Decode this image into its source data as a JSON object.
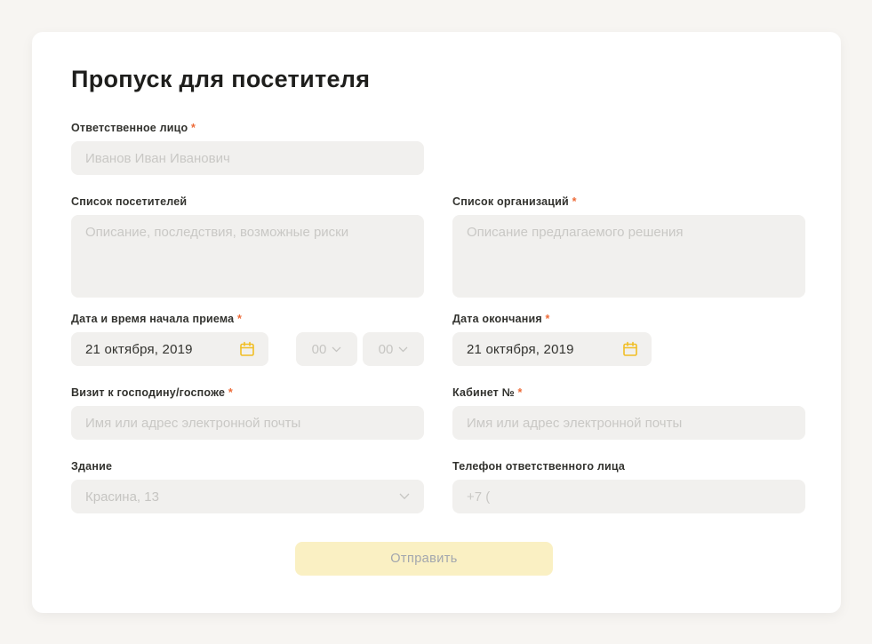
{
  "page": {
    "title": "Пропуск для посетителя"
  },
  "required_marker": "*",
  "form": {
    "responsible_label": "Ответственное лицо",
    "responsible_placeholder": "Иванов Иван Иванович",
    "visitors_label": "Список посетителей",
    "visitors_placeholder": "Описание, последствия, возможные риски",
    "organizations_label": "Список организаций",
    "organizations_placeholder": "Описание предлагаемого решения",
    "start_label": "Дата и время начала приема",
    "start_date_value": "21 октября, 2019",
    "start_hour_value": "00",
    "start_minute_value": "00",
    "end_label": "Дата окончания",
    "end_date_value": "21 октября, 2019",
    "visit_label": "Визит к господину/госпоже",
    "visit_placeholder": "Имя или адрес электронной почты",
    "cabinet_label": "Кабинет №",
    "cabinet_placeholder": "Имя или адрес электронной почты",
    "building_label": "Здание",
    "building_value": "Красина, 13",
    "phone_label": "Телефон ответственного лица",
    "phone_placeholder": "+7 (",
    "submit_label": "Отправить"
  },
  "colors": {
    "page_bg": "#F7F5F2",
    "card_bg": "#FFFFFF",
    "input_bg": "#F1F0EE",
    "placeholder_text": "#C9C8C5",
    "label_text": "#32322E",
    "required_asterisk": "#ED6A37",
    "calendar_icon": "#F1BE25",
    "submit_bg": "#FAF0C3",
    "submit_text": "#A2A6AE"
  }
}
